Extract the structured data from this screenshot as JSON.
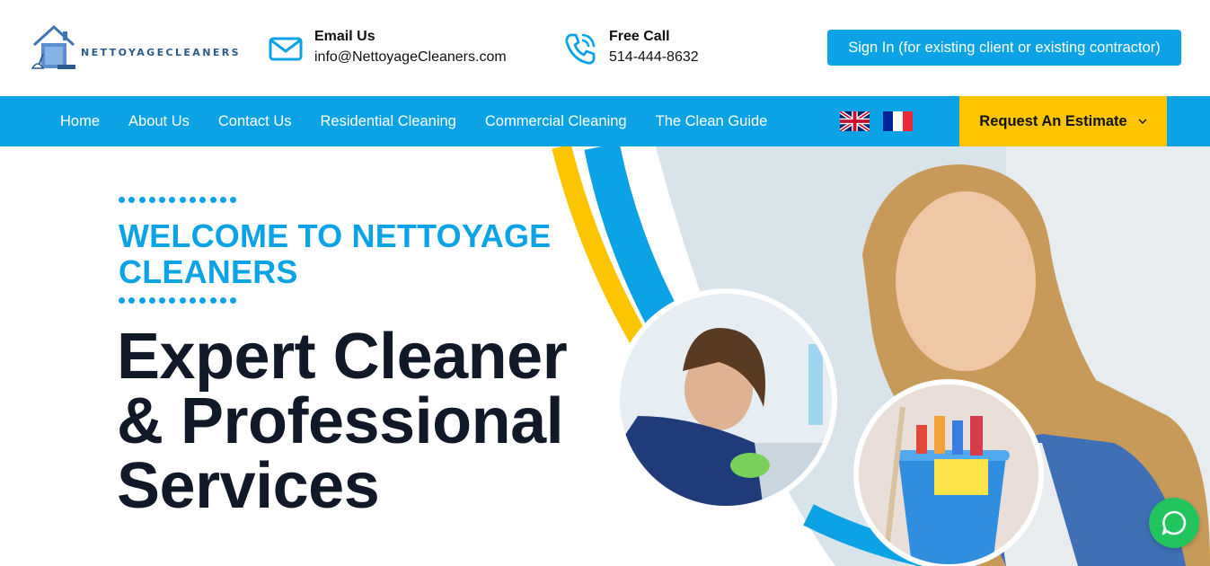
{
  "brand": {
    "name": "NETTOYAGECLEANERS"
  },
  "contact": {
    "email_title": "Email Us",
    "email_value": "info@NettoyageCleaners.com",
    "call_title": "Free Call",
    "call_value": "514-444-8632"
  },
  "header": {
    "signin_label": "Sign In (for existing client or existing contractor)"
  },
  "nav": {
    "items": [
      {
        "label": "Home"
      },
      {
        "label": "About Us"
      },
      {
        "label": "Contact Us"
      },
      {
        "label": "Residential Cleaning"
      },
      {
        "label": "Commercial Cleaning"
      },
      {
        "label": "The Clean Guide"
      }
    ],
    "languages": [
      "english-flag-icon",
      "french-flag-icon"
    ],
    "estimate_label": "Request An Estimate"
  },
  "hero": {
    "welcome": "WELCOME TO NETTOYAGE CLEANERS",
    "headline": "Expert Cleaner & Professional Services"
  },
  "icons": {
    "email": "envelope-icon",
    "call": "phone-icon",
    "chat": "whatsapp-icon",
    "dropdown": "chevron-down-icon"
  },
  "colors": {
    "primary_blue": "#0ba3e6",
    "accent_yellow": "#fdc500",
    "headline_dark": "#111827",
    "whatsapp_green": "#22c45e"
  }
}
